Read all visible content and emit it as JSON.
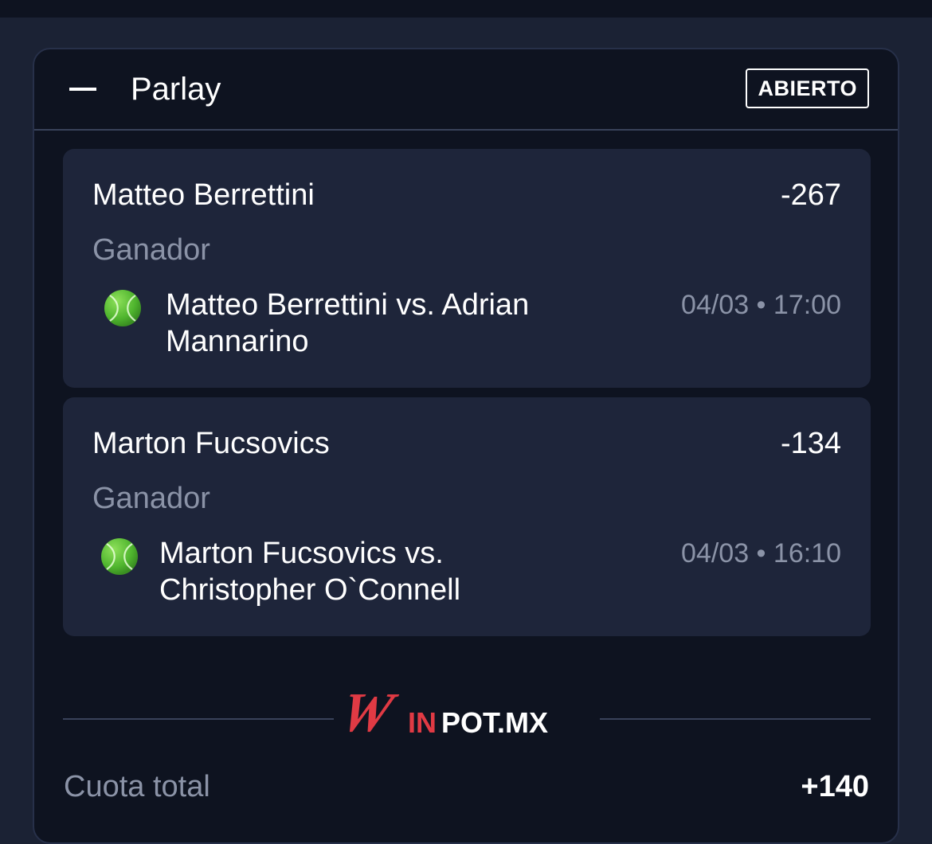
{
  "parlay": {
    "title": "Parlay",
    "status": "ABIERTO"
  },
  "bets": [
    {
      "selection": "Matteo Berrettini",
      "odds": "-267",
      "market": "Ganador",
      "sport_icon": "tennis-ball-icon",
      "match": "Matteo Berrettini vs. Adrian Mannarino",
      "datetime": "04/03 • 17:00"
    },
    {
      "selection": "Marton Fucsovics",
      "odds": "-134",
      "market": "Ganador",
      "sport_icon": "tennis-ball-icon",
      "match": "Marton Fucsovics vs. Christopher O`Connell",
      "datetime": "04/03 • 16:10"
    }
  ],
  "brand": {
    "logo_text_w": "W",
    "logo_text_in": "IN",
    "logo_text_rest": "POT.MX",
    "accent_color": "#e03a44"
  },
  "summary": {
    "total_label": "Cuota total",
    "total_value": "+140"
  },
  "colors": {
    "background": "#1b2234",
    "panel": "#0e1320",
    "card": "#1e253a",
    "muted_text": "#8b93a7",
    "tennis_ball": "#5cc43c"
  }
}
